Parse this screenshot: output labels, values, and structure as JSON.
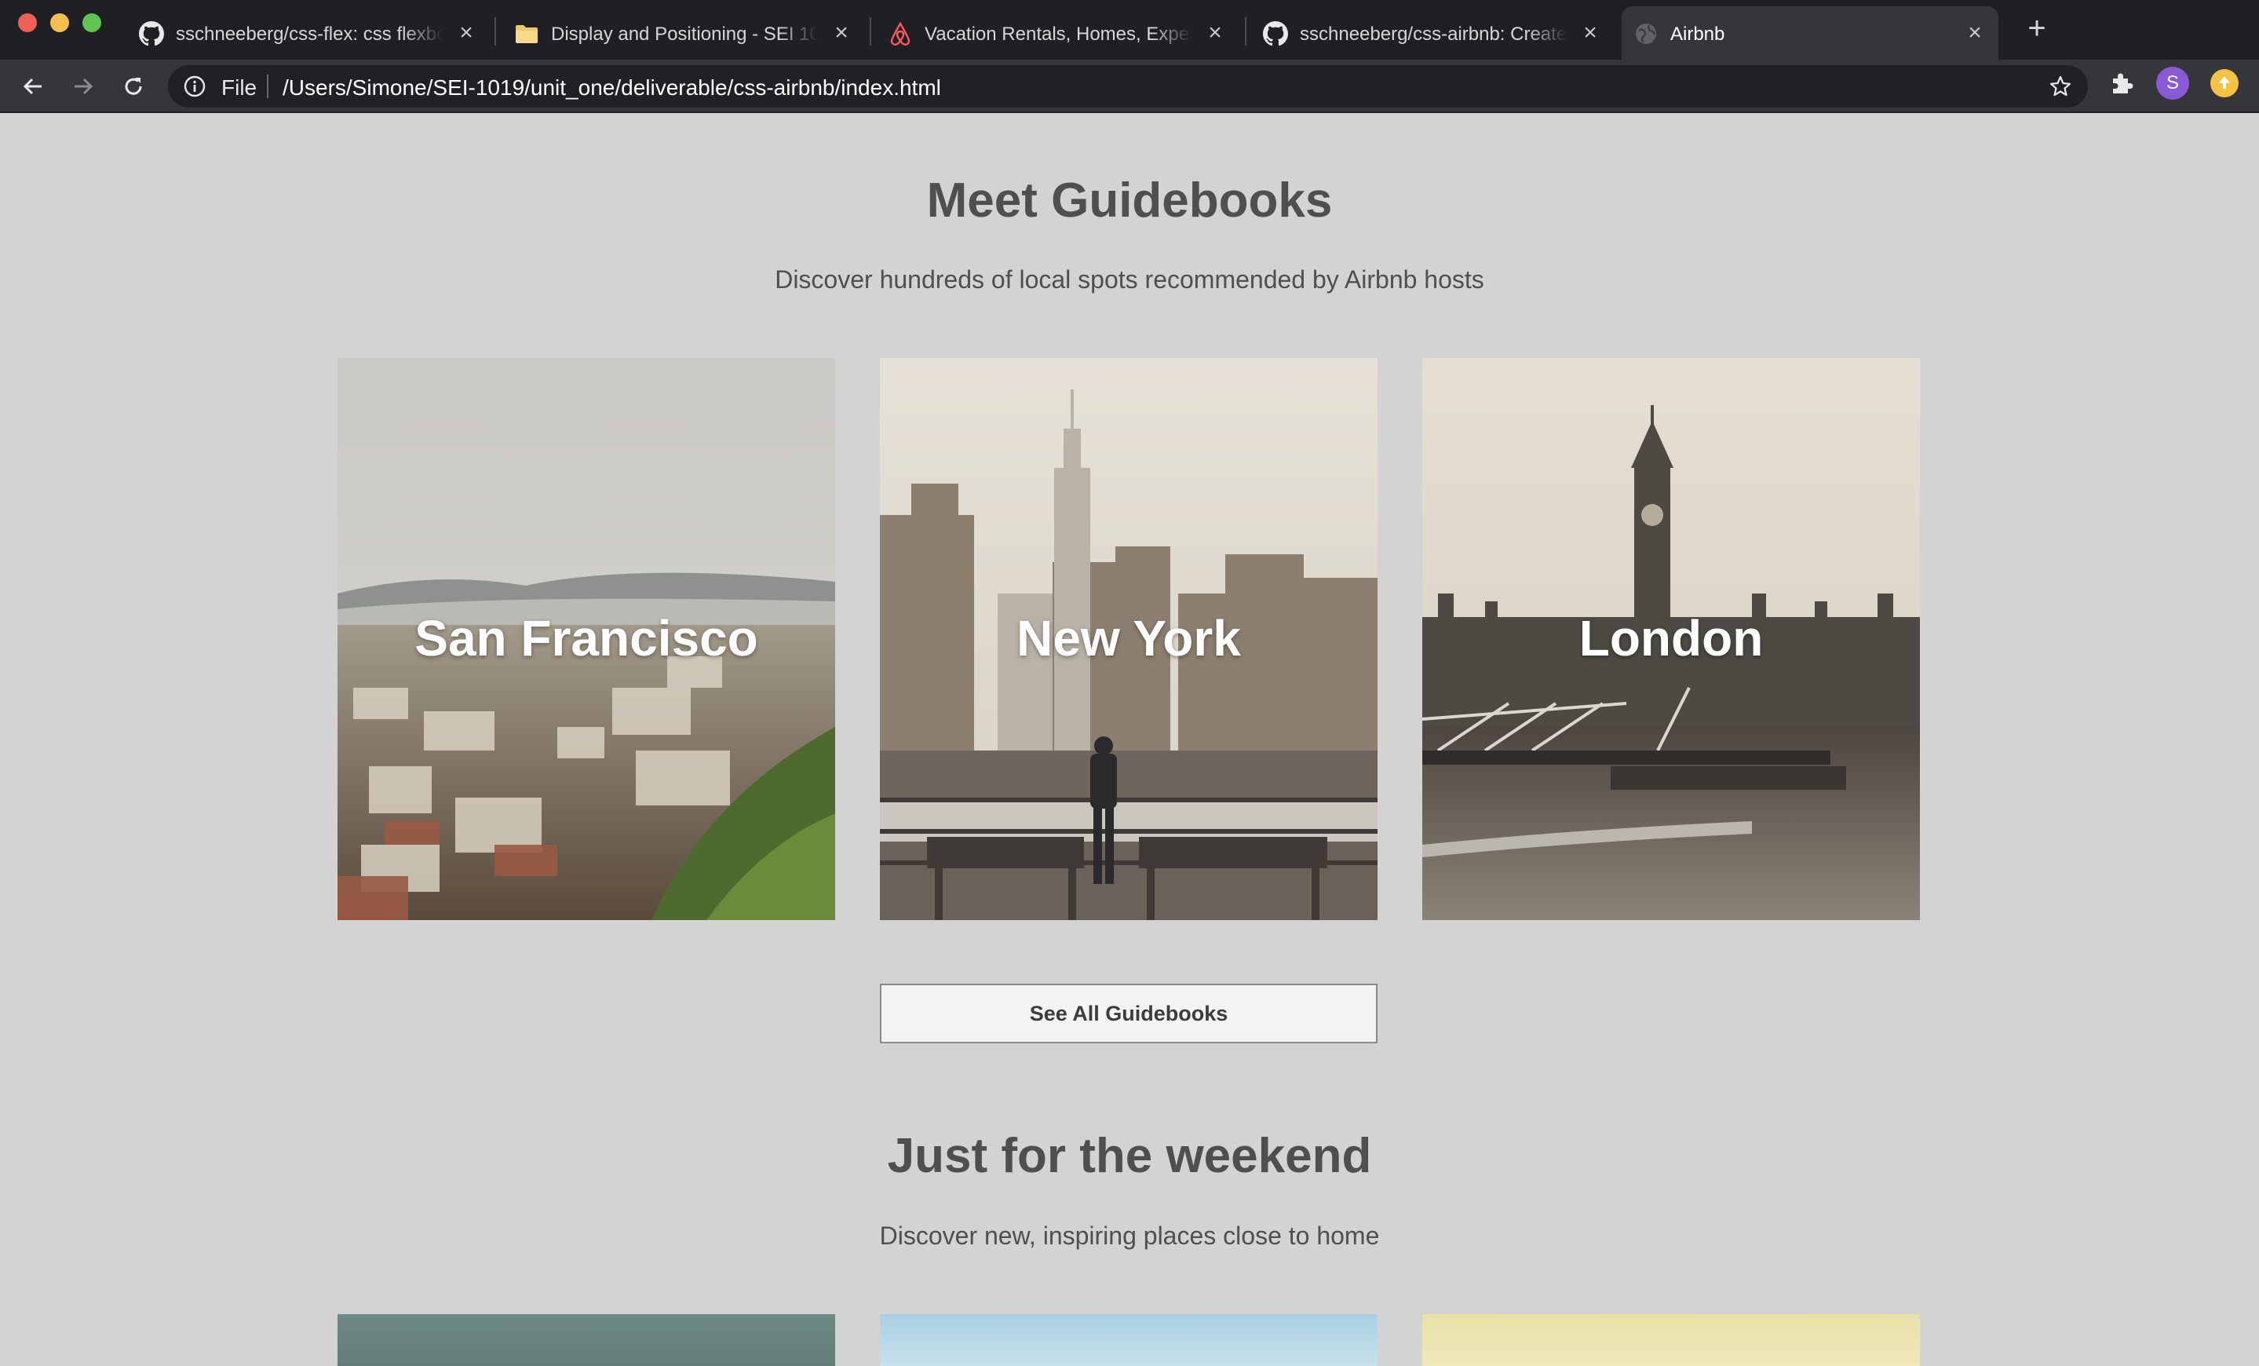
{
  "browser": {
    "tabs": [
      {
        "title": "sschneeberg/css-flex: css flexbox",
        "icon": "github-icon"
      },
      {
        "title": "Display and Positioning - SEI 1019",
        "icon": "folder-icon"
      },
      {
        "title": "Vacation Rentals, Homes, Experiences",
        "icon": "airbnb-icon"
      },
      {
        "title": "sschneeberg/css-airbnb: Create",
        "icon": "github-icon"
      },
      {
        "title": "Airbnb",
        "icon": "globe-icon"
      }
    ],
    "new_tab_label": "+",
    "omnibox": {
      "scheme_label": "File",
      "url": "/Users/Simone/SEI-1019/unit_one/deliverable/css-airbnb/index.html"
    },
    "profile_initial": "S",
    "colors": {
      "frame": "#1f2023",
      "toolbar": "#35363a",
      "omnibox": "#202124",
      "profile": "#8a5ad6",
      "update": "#f5c343"
    }
  },
  "guidebooks": {
    "title": "Meet Guidebooks",
    "subtitle": "Discover hundreds of local spots recommended by Airbnb hosts",
    "cities": [
      {
        "name": "San Francisco"
      },
      {
        "name": "New York"
      },
      {
        "name": "London"
      }
    ],
    "button_label": "See All Guidebooks"
  },
  "weekend": {
    "title": "Just for the weekend",
    "subtitle": "Discover new, inspiring places close to home"
  },
  "page_colors": {
    "background": "#d3d3d3",
    "heading": "#4f4f4f",
    "button_bg": "#f3f3f3"
  }
}
